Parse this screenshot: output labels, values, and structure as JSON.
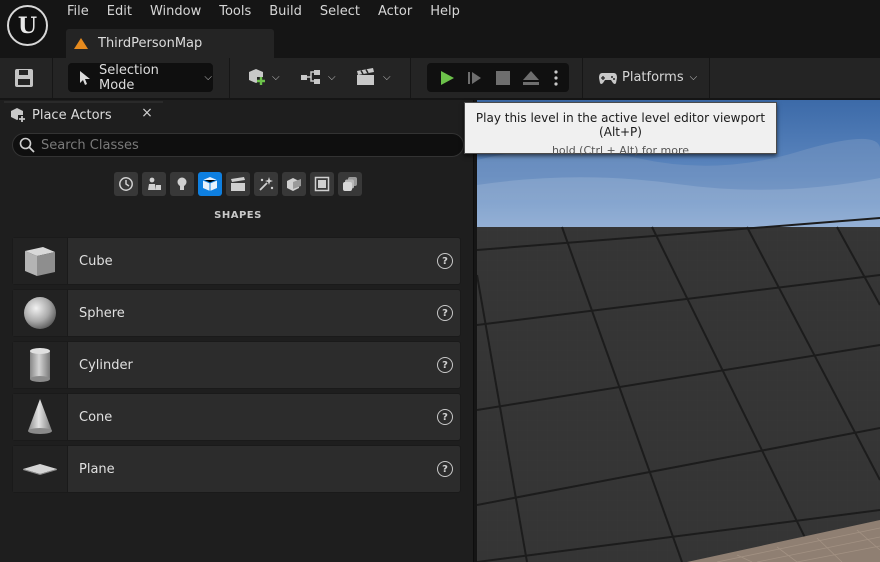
{
  "app": {
    "logo_letter": "U"
  },
  "menu": [
    "File",
    "Edit",
    "Window",
    "Tools",
    "Build",
    "Select",
    "Actor",
    "Help"
  ],
  "tab": {
    "label": "ThirdPersonMap"
  },
  "toolbar": {
    "selection_mode": "Selection Mode",
    "platforms": "Platforms"
  },
  "tooltip": {
    "main": "Play this level in the active level editor viewport (Alt+P)",
    "sub": "hold (Ctrl + Alt) for more"
  },
  "panel": {
    "title": "Place Actors",
    "close_glyph": "×",
    "search_placeholder": "Search Classes",
    "categories": [
      "recent-icon",
      "basic-icon",
      "lights-icon",
      "shapes-icon",
      "cinematic-icon",
      "visual-effects-icon",
      "volumes-icon",
      "all-classes-icon",
      "more-icon"
    ],
    "active_category": "shapes-icon",
    "section_heading": "SHAPES",
    "items": [
      {
        "name": "Cube",
        "icon": "cube-icon"
      },
      {
        "name": "Sphere",
        "icon": "sphere-icon"
      },
      {
        "name": "Cylinder",
        "icon": "cylinder-icon"
      },
      {
        "name": "Cone",
        "icon": "cone-icon"
      },
      {
        "name": "Plane",
        "icon": "plane-icon"
      }
    ],
    "help_glyph": "?"
  },
  "colors": {
    "accent": "#0e7fe0",
    "play_green": "#6cc24a",
    "map_icon": "#e68a1e"
  }
}
